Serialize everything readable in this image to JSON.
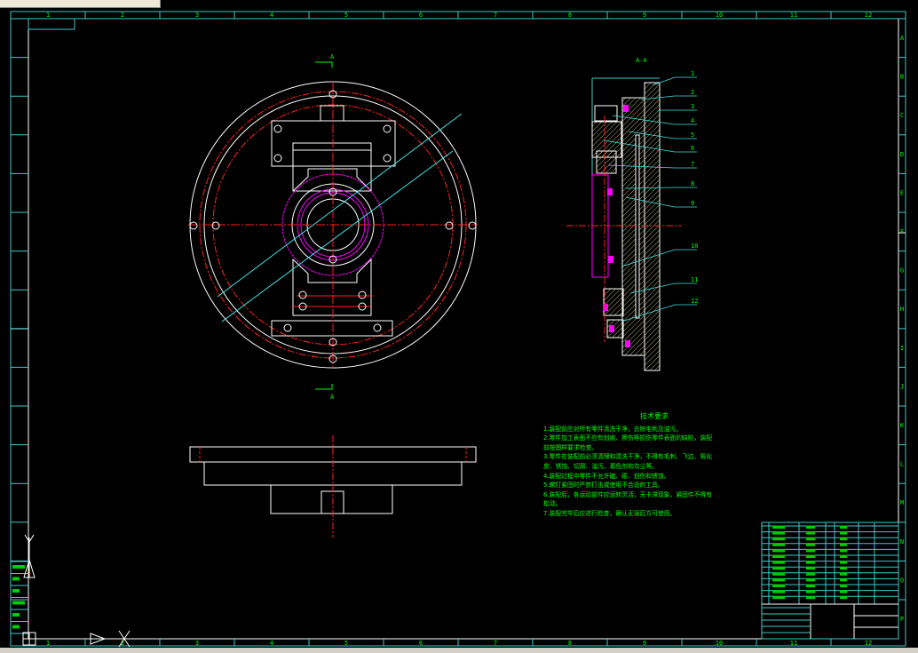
{
  "columns": [
    "1",
    "2",
    "3",
    "4",
    "5",
    "6",
    "7",
    "8",
    "9",
    "10",
    "11",
    "12"
  ],
  "rows": [
    "A",
    "B",
    "C",
    "D",
    "E",
    "F",
    "G",
    "H",
    "I",
    "J",
    "K",
    "L",
    "M",
    "N",
    "O",
    "P"
  ],
  "section_label": "A-A",
  "cut_label_top": "A",
  "cut_label_bottom": "A",
  "part_numbers": [
    "1",
    "2",
    "3",
    "4",
    "5",
    "6",
    "7",
    "8",
    "9",
    "10",
    "11",
    "12"
  ],
  "tech_requirements": {
    "title": "技术要求",
    "items": [
      "1.装配前应对所有零件清洗干净，去除毛刺及油污。",
      "2.零件加工表面不应有划痕、擦伤等损伤零件表面的缺陷，装配前按图样要求检查。",
      "3.零件在装配前必须清理和清洗干净，不得有毛刺、飞边、氧化皮、锈蚀、切屑、油污、着色剂和灰尘等。",
      "4.装配过程中零件不允许磕、碰、划伤和锈蚀。",
      "5.螺钉紧固时严禁打击或使用不合适的工具。",
      "6.装配后，各运动部件应运转灵活，无卡滞现象，紧固件不得有松动。",
      "7.装配完毕后应进行检查，确认无误后方可使用。"
    ]
  },
  "colors": {
    "frame": "#40c8c8",
    "text": "#00ff00",
    "geometry": "#ffffff",
    "center": "#ff2020",
    "highlight": "#ff00ff",
    "hatch": "#e8e8a0"
  }
}
